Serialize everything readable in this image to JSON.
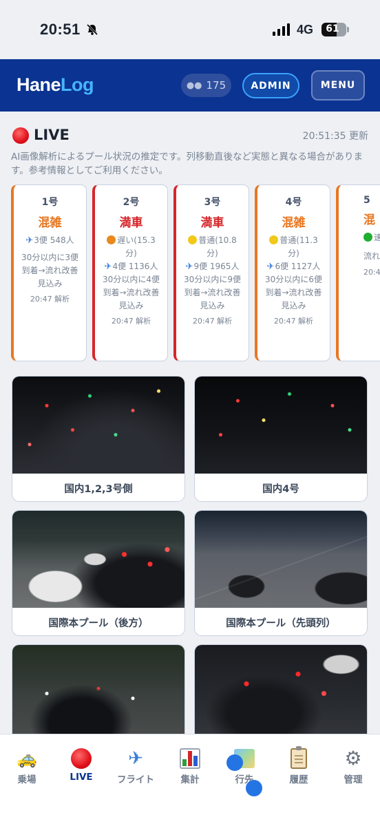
{
  "status_bar": {
    "time": "20:51",
    "network": "4G",
    "battery": "61",
    "battery_level": 0.61
  },
  "header": {
    "logo_part1": "Hane",
    "logo_part2": "Log",
    "users_count": "175",
    "admin_label": "ADMIN",
    "menu_label": "MENU"
  },
  "live": {
    "title": "LIVE",
    "updated": "20:51:35 更新",
    "note": "AI画像解析によるプール状況の推定です。列移動直後など実態と異なる場合があります。参考情報としてご利用ください。"
  },
  "cards": [
    {
      "num": "1号",
      "status": "混雑",
      "tone": "orange",
      "flights": "3便 548人",
      "lines": [
        "30分以内に3便",
        "到着→流れ改善",
        "見込み"
      ],
      "analyzed": "20:47 解析"
    },
    {
      "num": "2号",
      "status": "満車",
      "tone": "red",
      "speed": "遅い(15.3",
      "speed2": "分)",
      "speed_color": "#e8891c",
      "flights": "4便 1136人",
      "lines": [
        "30分以内に4便",
        "到着→流れ改善",
        "見込み"
      ],
      "analyzed": "20:47 解析"
    },
    {
      "num": "3号",
      "status": "満車",
      "tone": "red",
      "speed": "普通(10.8",
      "speed2": "分)",
      "speed_color": "#f2c81a",
      "flights": "9便 1965人",
      "lines": [
        "30分以内に9便",
        "到着→流れ改善",
        "見込み"
      ],
      "analyzed": "20:47 解析"
    },
    {
      "num": "4号",
      "status": "混雑",
      "tone": "orange",
      "speed": "普通(11.3",
      "speed2": "分)",
      "speed_color": "#f2c81a",
      "flights": "6便 1127人",
      "lines": [
        "30分以内に6便",
        "到着→流れ改善",
        "見込み"
      ],
      "analyzed": "20:47 解析"
    },
    {
      "num": "5",
      "status": "混",
      "tone": "orange",
      "speed": "速",
      "speed_color": "#1fae2f",
      "flights": "",
      "lines": [
        "流れ"
      ],
      "analyzed": "20:4"
    }
  ],
  "cameras": [
    {
      "caption": "国内1,2,3号側"
    },
    {
      "caption": "国内4号"
    },
    {
      "caption": "国際本プール（後方）"
    },
    {
      "caption": "国際本プール（先頭列）"
    },
    {
      "caption": ""
    },
    {
      "caption": ""
    }
  ],
  "nav": [
    {
      "label": "乗場",
      "icon": "taxi-icon"
    },
    {
      "label": "LIVE",
      "icon": "red-circle-icon"
    },
    {
      "label": "フライト",
      "icon": "airplane-icon"
    },
    {
      "label": "集計",
      "icon": "bar-chart-icon"
    },
    {
      "label": "行先",
      "icon": "map-icon"
    },
    {
      "label": "履歴",
      "icon": "clipboard-icon"
    },
    {
      "label": "管理",
      "icon": "gear-icon"
    }
  ],
  "colors": {
    "header": "#0b3391",
    "accent": "#46b4ff",
    "red": "#d6262a",
    "orange": "#e87722"
  }
}
